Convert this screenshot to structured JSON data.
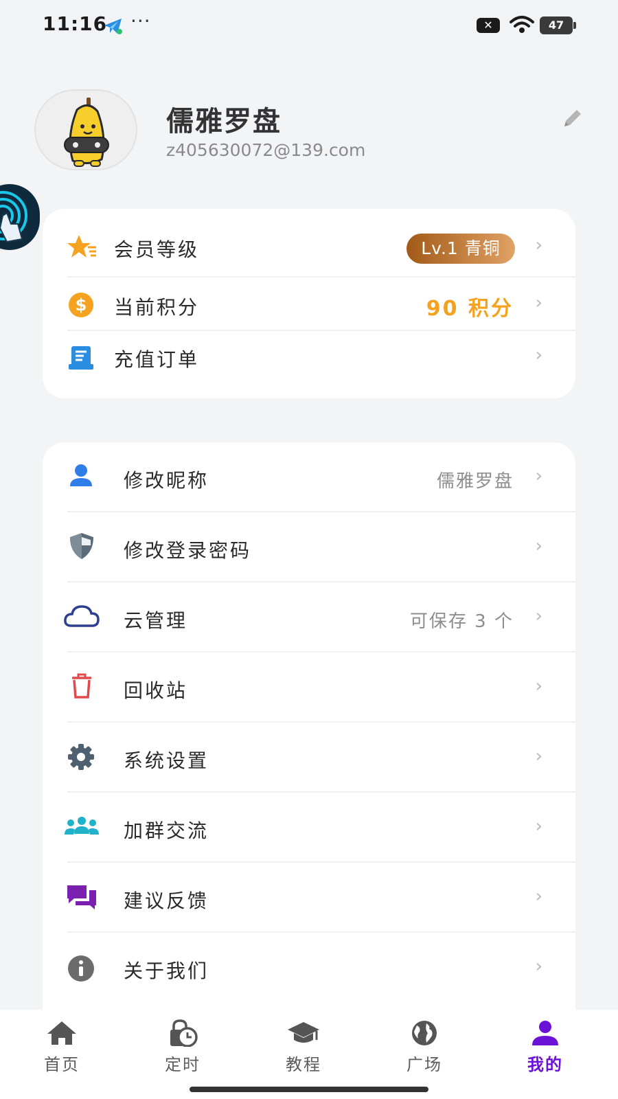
{
  "status_bar": {
    "time": "11:16",
    "more": "···",
    "x_badge": "✕",
    "battery": "47"
  },
  "profile": {
    "name": "儒雅罗盘",
    "email": "z405630072@139.com"
  },
  "account_card": {
    "items": [
      {
        "label": "会员等级",
        "badge": "Lv.1 青铜",
        "icon": "star-icon"
      },
      {
        "label": "当前积分",
        "value": "90 积分",
        "icon": "coin-icon"
      },
      {
        "label": "充值订单",
        "icon": "receipt-icon"
      }
    ]
  },
  "settings_card": {
    "items": [
      {
        "label": "修改昵称",
        "value": "儒雅罗盘",
        "icon": "user-icon"
      },
      {
        "label": "修改登录密码",
        "icon": "shield-icon"
      },
      {
        "label": "云管理",
        "value": "可保存 3 个",
        "icon": "cloud-icon"
      },
      {
        "label": "回收站",
        "icon": "trash-icon"
      },
      {
        "label": "系统设置",
        "icon": "gear-icon"
      },
      {
        "label": "加群交流",
        "icon": "group-icon"
      },
      {
        "label": "建议反馈",
        "icon": "chat-icon"
      },
      {
        "label": "关于我们",
        "icon": "info-icon"
      }
    ]
  },
  "chevron": "›",
  "tabbar": {
    "tabs": [
      {
        "label": "首页",
        "icon": "home-icon"
      },
      {
        "label": "定时",
        "icon": "timer-icon"
      },
      {
        "label": "教程",
        "icon": "graduation-cap-icon"
      },
      {
        "label": "广场",
        "icon": "globe-icon"
      },
      {
        "label": "我的",
        "icon": "user-icon",
        "active": true
      }
    ]
  },
  "colors": {
    "accent": "#6a12d6",
    "points": "#f4a21f",
    "badge_from": "#a35a18",
    "badge_to": "#e0a265"
  }
}
